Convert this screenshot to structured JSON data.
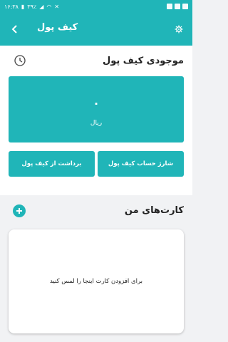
{
  "status_bar": {
    "time": "۱۶:۳۸",
    "battery": "۳۹٪"
  },
  "header": {
    "title": "کیف پول",
    "back_icon": "chevron-left-icon",
    "settings_icon": "gear-icon"
  },
  "balance": {
    "title": "موجودی کیف پول",
    "value": "۰",
    "currency": "ریال",
    "history_icon": "history-icon"
  },
  "actions": {
    "charge_label": "شارژ حساب کیف پول",
    "withdraw_label": "برداشت از کیف پول"
  },
  "cards": {
    "title": "کارت‌های من",
    "add_hint": "برای افزودن کارت اینجا را لمس کنید",
    "add_icon": "plus-icon"
  },
  "colors": {
    "accent": "#20b5b8",
    "background": "#f1f2f4"
  }
}
